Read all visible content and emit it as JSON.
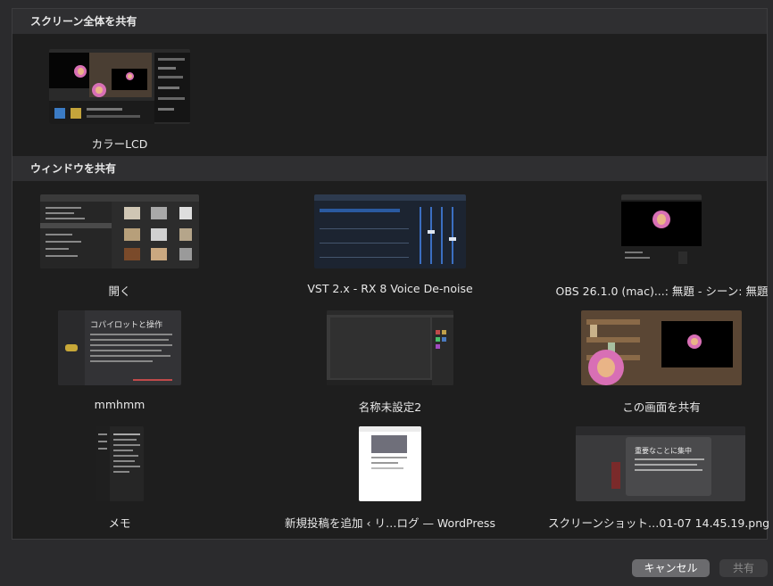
{
  "sections": {
    "screen_header": "スクリーン全体を共有",
    "window_header": "ウィンドウを共有"
  },
  "screen": {
    "label": "カラーLCD"
  },
  "windows": [
    {
      "label": "開く"
    },
    {
      "label": "VST 2.x - RX 8 Voice De-noise"
    },
    {
      "label": "OBS 26.1.0 (mac)...: 無題 - シーン: 無題"
    },
    {
      "label": "mmhmm"
    },
    {
      "label": "名称未設定2"
    },
    {
      "label": "この画面を共有"
    },
    {
      "label": "メモ"
    },
    {
      "label": "新規投稿を追加 ‹ リ…ログ — WordPress"
    },
    {
      "label": "スクリーンショット…01-07 14.45.19.png"
    }
  ],
  "thumb_text": {
    "mmhmm_title": "コパイロットと操作",
    "screenshot_title": "重要なことに集中"
  },
  "buttons": {
    "cancel": "キャンセル",
    "share": "共有"
  },
  "colors": {
    "background": "#2b2b2d",
    "panel": "#1e1e1e",
    "header": "#2f2f31",
    "accent_pink": "#d86fb5"
  }
}
